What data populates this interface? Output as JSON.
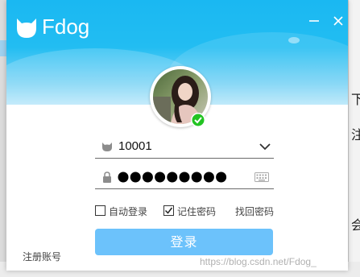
{
  "app": {
    "title": "Fdog"
  },
  "login": {
    "account": "10001",
    "password_dots": 9,
    "auto_login_label": "自动登录",
    "auto_login_checked": false,
    "remember_label": "记住密码",
    "remember_checked": true,
    "find_password_label": "找回密码",
    "submit_label": "登录",
    "register_label": "注册账号"
  },
  "watermark": "https://blog.csdn.net/Fdog_",
  "background_fragments": [
    "下",
    "注",
    "会"
  ],
  "colors": {
    "header_top": "#1ab8f2",
    "button": "#6cc2fb",
    "online_status": "#22c322"
  },
  "icons": [
    "cat-logo-icon",
    "minimize-icon",
    "close-icon",
    "user-icon",
    "chevron-down-icon",
    "lock-icon",
    "keyboard-icon",
    "online-check-icon"
  ]
}
